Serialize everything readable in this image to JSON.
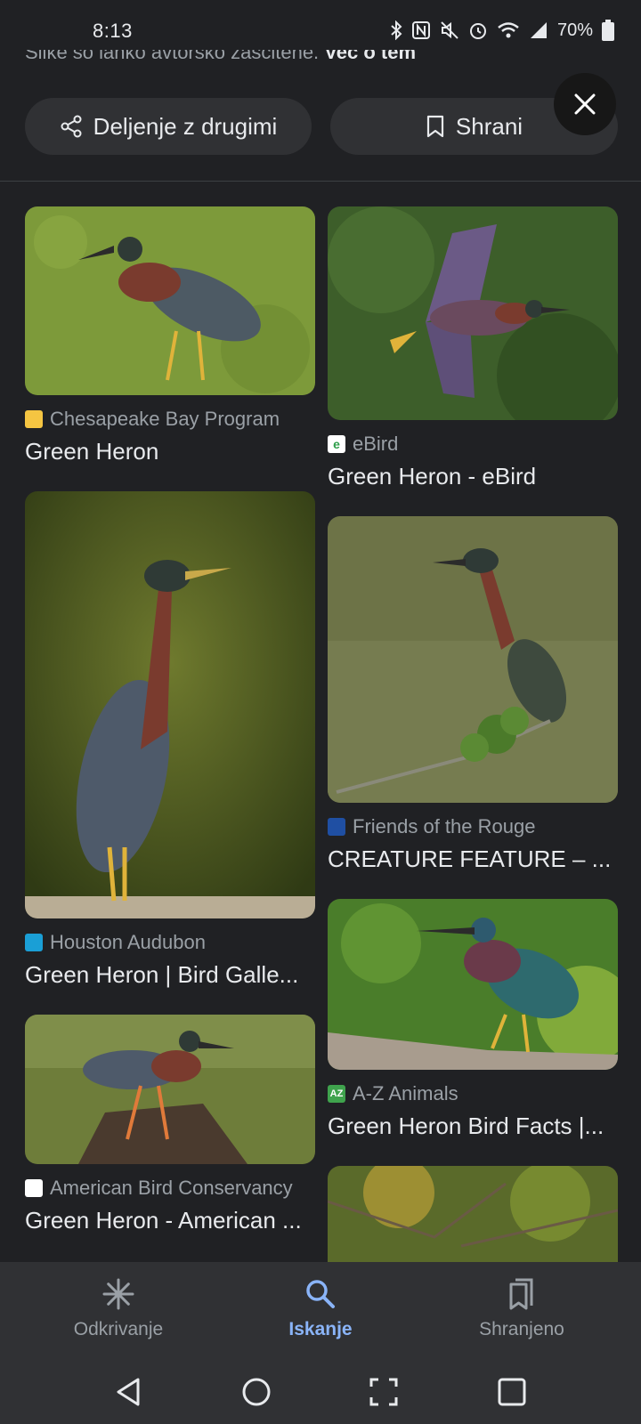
{
  "status": {
    "time": "8:13",
    "battery": "70%",
    "icons": [
      "bluetooth-icon",
      "nfc-icon",
      "mute-icon",
      "alarm-icon",
      "wifi-icon",
      "signal-icon",
      "battery-icon"
    ]
  },
  "notice": {
    "text": "Slike so lahko avtorsko zaščitene.",
    "link": "Več o tem"
  },
  "actions": {
    "share_label": "Deljenje z drugimi",
    "save_label": "Shrani"
  },
  "results": {
    "left": [
      {
        "source": "Chesapeake Bay Program",
        "title": "Green Heron",
        "favicon_color": "#f5c542"
      },
      {
        "source": "Houston Audubon",
        "title": "Green Heron | Bird Galle...",
        "favicon_color": "#1a9fd6"
      },
      {
        "source": "American Bird Conservancy",
        "title": "Green Heron - American ...",
        "favicon_color": "#ffffff"
      }
    ],
    "right": [
      {
        "source": "eBird",
        "title": "Green Heron - eBird",
        "favicon_color": "#ffffff"
      },
      {
        "source": "Friends of the Rouge",
        "title": "CREATURE FEATURE – ...",
        "favicon_color": "#1f4fa3"
      },
      {
        "source": "A-Z Animals",
        "title": "Green Heron Bird Facts |...",
        "favicon_color": "#3fa34d"
      }
    ]
  },
  "bottom_nav": {
    "discover": "Odkrivanje",
    "search": "Iskanje",
    "saved": "Shranjeno"
  },
  "colors": {
    "background": "#202124",
    "surface": "#303134",
    "accent": "#8ab4f8",
    "text": "#e8eaed",
    "muted": "#9aa0a6"
  }
}
